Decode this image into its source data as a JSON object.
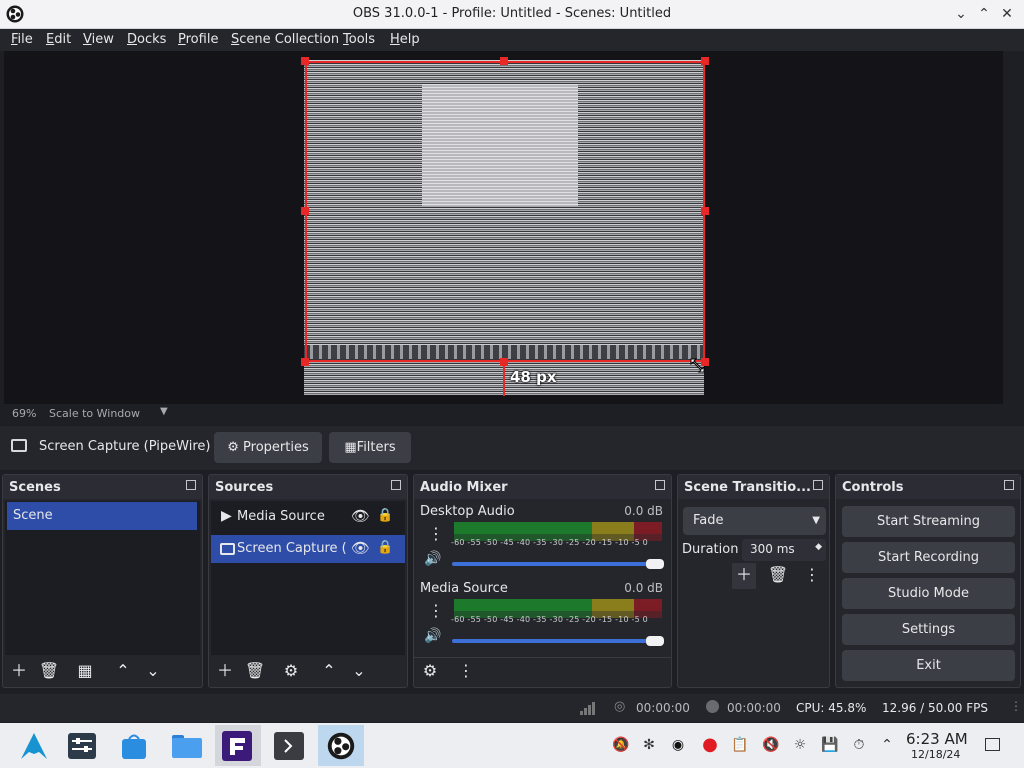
{
  "window": {
    "title": "OBS 31.0.0-1 - Profile: Untitled - Scenes: Untitled"
  },
  "menu": [
    "File",
    "Edit",
    "View",
    "Docks",
    "Profile",
    "Scene Collection",
    "Tools",
    "Help"
  ],
  "preview": {
    "measure_label": "48 px",
    "zoom": "69%",
    "scale_mode": "Scale to Window"
  },
  "source_toolbar": {
    "source_name": "Screen Capture (PipeWire)",
    "properties_label": "Properties",
    "filters_label": "Filters"
  },
  "docks": {
    "scenes": {
      "title": "Scenes",
      "items": [
        "Scene"
      ]
    },
    "sources": {
      "title": "Sources",
      "items": [
        "Media Source",
        "Screen Capture (PipeWire)"
      ]
    },
    "audio": {
      "title": "Audio Mixer",
      "channels": [
        {
          "name": "Desktop Audio",
          "level": "0.0 dB"
        },
        {
          "name": "Media Source",
          "level": "0.0 dB"
        }
      ],
      "ticks": "-60 -55 -50 -45 -40 -35 -30 -25 -20 -15 -10 -5 0"
    },
    "transitions": {
      "title": "Scene Transitio...",
      "transition": "Fade",
      "duration_label": "Duration",
      "duration_value": "300 ms"
    },
    "controls": {
      "title": "Controls",
      "buttons": [
        "Start Streaming",
        "Start Recording",
        "Studio Mode",
        "Settings",
        "Exit"
      ]
    }
  },
  "status": {
    "stream_time": "00:00:00",
    "rec_time": "00:00:00",
    "cpu": "CPU: 45.8%",
    "fps": "12.96 / 50.00 FPS"
  },
  "clock": {
    "time": "6:23 AM",
    "date": "12/18/24"
  }
}
